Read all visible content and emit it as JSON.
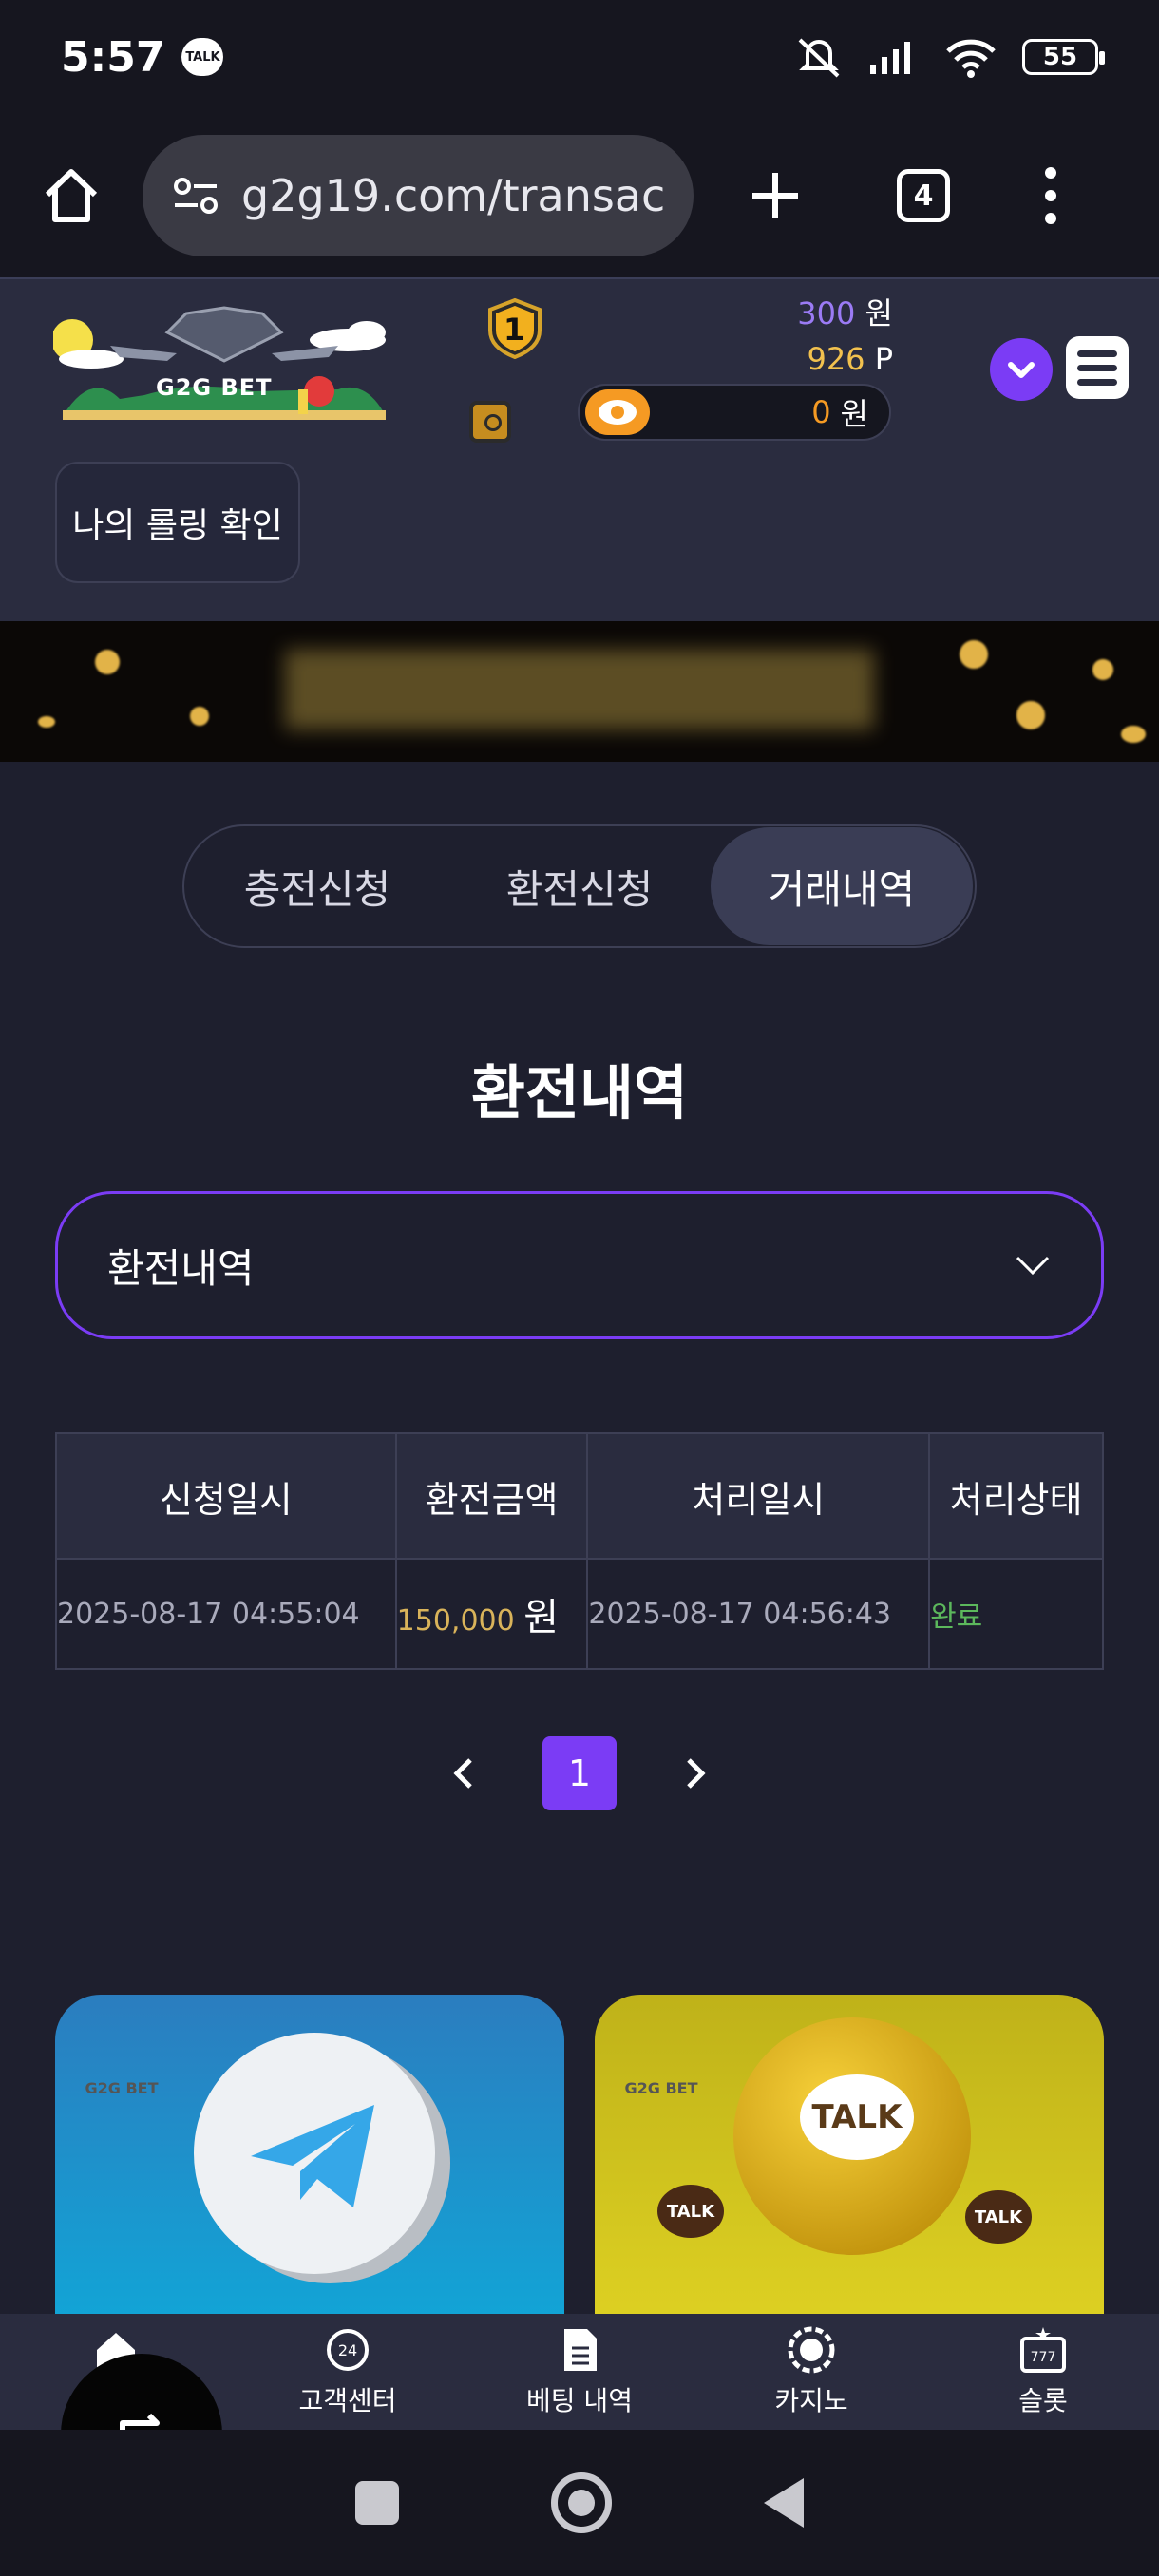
{
  "status_bar": {
    "time": "5:57",
    "notif_label": "TALK",
    "battery": "55"
  },
  "browser": {
    "url": "g2g19.com/transac",
    "tab_count": "4"
  },
  "header": {
    "logo_text": "G2G BET",
    "level": "1",
    "cash_amount": "300",
    "cash_unit": "원",
    "point_amount": "926",
    "point_unit": "P",
    "wallet_amount": "0",
    "wallet_unit": "원"
  },
  "rolling_button": "나의 롤링 확인",
  "tabs": [
    {
      "label": "충전신청",
      "active": false
    },
    {
      "label": "환전신청",
      "active": false
    },
    {
      "label": "거래내역",
      "active": true
    }
  ],
  "section_title": "환전내역",
  "filter": {
    "selected": "환전내역"
  },
  "table": {
    "headers": [
      "신청일시",
      "환전금액",
      "처리일시",
      "처리상태"
    ],
    "rows": [
      {
        "requested": "2025-08-17 04:55:04",
        "amount": "150,000",
        "unit": "원",
        "processed": "2025-08-17 04:56:43",
        "status": "완료"
      }
    ]
  },
  "pagination": {
    "current": "1"
  },
  "promo": {
    "kakao_label": "TALK",
    "logo_text": "G2G BET"
  },
  "bottom_nav": [
    {
      "label": "홈",
      "icon": "home-icon"
    },
    {
      "label": "고객센터",
      "icon": "support-24-icon"
    },
    {
      "label": "베팅 내역",
      "icon": "document-icon"
    },
    {
      "label": "카지노",
      "icon": "casino-chip-icon"
    },
    {
      "label": "슬롯",
      "icon": "slot-machine-icon"
    }
  ],
  "colors": {
    "accent": "#7b3cf5",
    "cash": "#9b7bf5",
    "point": "#f2c14e",
    "wallet": "#f59a23",
    "status_done": "#5cb85c",
    "background": "#1e1f2e"
  }
}
